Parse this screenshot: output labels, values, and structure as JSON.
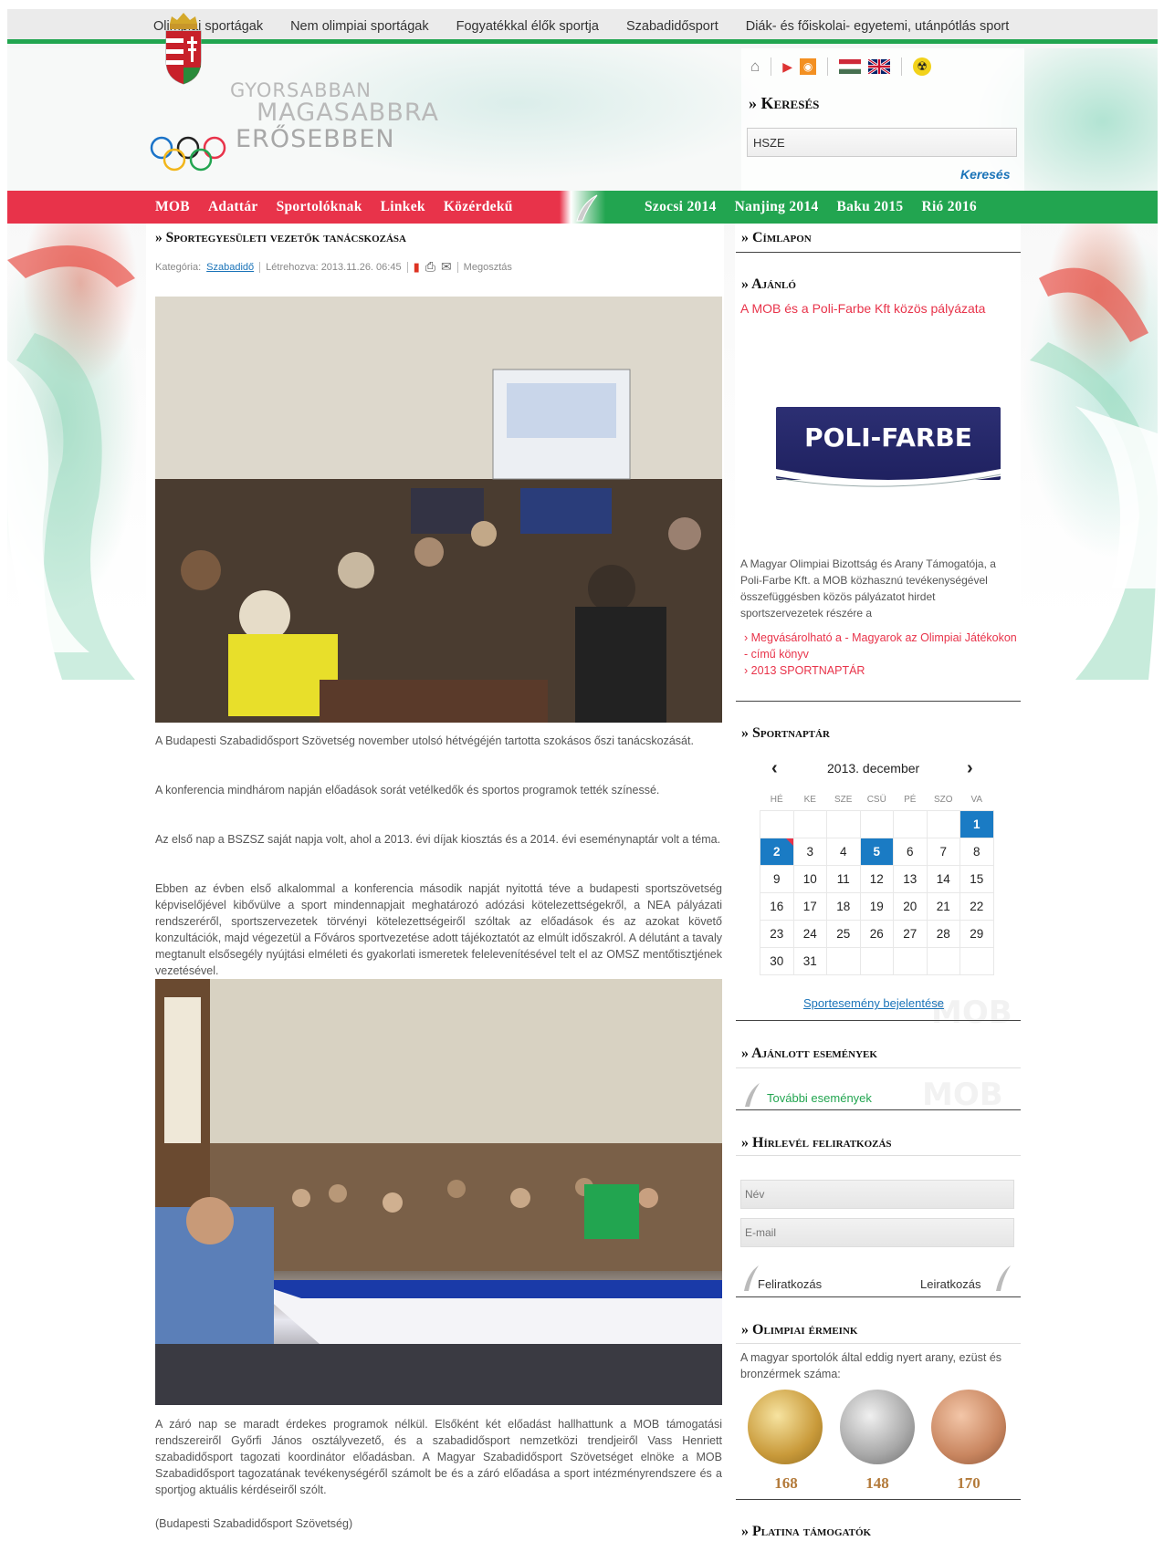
{
  "topnav": [
    "Olimpiai sportágak",
    "Nem olimpiai sportágak",
    "Fogyatékkal élők sportja",
    "Szabadidősport",
    "Diák- és főiskolai- egyetemi, utánpótlás sport"
  ],
  "logo": {
    "line1": "GYORSABBAN",
    "line2": "MAGASABBRA",
    "line3": "ERŐSEBBEN"
  },
  "search": {
    "title": "» Keresés",
    "value": "HSZE",
    "button": "Keresés"
  },
  "mainnav": {
    "left": [
      "MOB",
      "Adattár",
      "Sportolóknak",
      "Linkek",
      "Közérdekű"
    ],
    "right": [
      "Szocsi 2014",
      "Nanjing 2014",
      "Baku 2015",
      "Rió 2016"
    ]
  },
  "article": {
    "title": "» Sportegyesületi vezetők tanácskozása",
    "category_label": "Kategória:",
    "category": "Szabadidő",
    "created": "Létrehozva: 2013.11.26. 06:45",
    "share": "Megosztás",
    "paragraphs": [
      "A Budapesti Szabadidősport Szövetség november utolsó hétvégéjén tartotta szokásos őszi tanácskozását.",
      "A konferencia mindhárom napján előadások sorát vetélkedők és sportos programok tették színessé.",
      "Az első nap a BSZSZ saját napja volt, ahol a 2013. évi díjak kiosztás és a 2014. évi eseménynaptár volt a téma.",
      "Ebben az évben első alkalommal a konferencia második napját nyitottá téve a budapesti sportszövetség képviselőjével kibővülve a sport mindennapjait meghatározó adózási kötelezettségekről, a NEA pályázati rendszeréről, sportszervezetek törvényi kötelezettségeiről szóltak az előadások és az azokat követő konzultációk, majd végezetül a Főváros sportvezetése adott tájékoztatót az elmúlt időszakról. A délutánt a tavaly megtanult elsősegély nyújtási elméleti és gyakorlati ismeretek felelevenítésével telt el az OMSZ mentőtisztjének vezetésével.",
      "A záró nap se maradt érdekes programok nélkül. Elsőként két előadást hallhattunk a MOB támogatási rendszereiről Győrfi János osztályvezető, és a szabadidősport nemzetközi trendjeiről Vass Henriett szabadidősport tagozati koordinátor előadásban. A Magyar Szabadidősport Szövetséget elnöke a MOB Szabadidősport tagozatának tevékenységéről számolt be és a záró előadása a sport intézményrendszere és a sportjog aktuális kérdéseiről szólt.",
      "(Budapesti Szabadidősport Szövetség)"
    ]
  },
  "sidebar": {
    "cimlapon": "» Címlapon",
    "ajanlo": {
      "title": "» Ajánló",
      "link": "A MOB és a Poli-Farbe Kft közös pályázata",
      "banner": "POLI-FARBE",
      "desc": "A Magyar Olimpiai Bizottság és Arany Támogatója, a Poli-Farbe Kft. a MOB közhasznú tevékenységével összefüggésben közös pályázatot hirdet sportszervezetek részére a",
      "list": [
        "Megvásárolható a - Magyarok az Olimpiai Játékokon - című könyv",
        "2013 SPORTNAPTÁR"
      ]
    },
    "sportnaptar": {
      "title": "» Sportnaptár",
      "month": "2013. december",
      "weekdays": [
        "HÉ",
        "KE",
        "SZE",
        "CSÜ",
        "PÉ",
        "SZO",
        "VA"
      ],
      "weeks": [
        [
          "",
          "",
          "",
          "",
          "",
          "",
          "1"
        ],
        [
          "2",
          "3",
          "4",
          "5",
          "6",
          "7",
          "8"
        ],
        [
          "9",
          "10",
          "11",
          "12",
          "13",
          "14",
          "15"
        ],
        [
          "16",
          "17",
          "18",
          "19",
          "20",
          "21",
          "22"
        ],
        [
          "23",
          "24",
          "25",
          "26",
          "27",
          "28",
          "29"
        ],
        [
          "30",
          "31",
          "",
          "",
          "",
          "",
          ""
        ]
      ],
      "report": "Sportesemény bejelentése"
    },
    "ajanlott": {
      "title": "» Ajánlott események",
      "more": "További események"
    },
    "hirlevel": {
      "title": "» Hírlevél feliratkozás",
      "name_placeholder": "Név",
      "email_placeholder": "E-mail",
      "subscribe": "Feliratkozás",
      "unsubscribe": "Leiratkozás"
    },
    "ermek": {
      "title": "» Olimpiai érmeink",
      "desc": "A magyar sportolók által eddig nyert arany, ezüst és bronzérmek száma:",
      "gold": "168",
      "silver": "148",
      "bronze": "170"
    },
    "platina": "» Platina támogatók",
    "watermark": "MOB"
  },
  "colors": {
    "red": "#e8334a",
    "green": "#22a550",
    "blue": "#1a7bc4"
  }
}
